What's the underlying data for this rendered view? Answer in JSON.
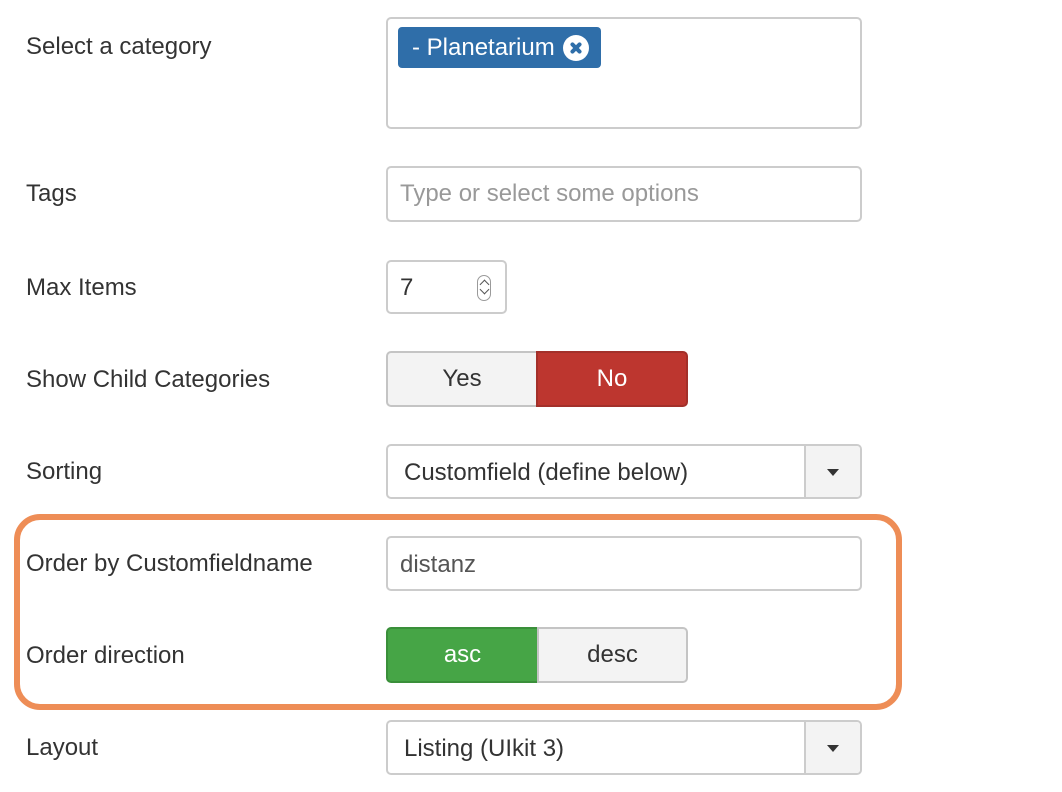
{
  "fields": {
    "category": {
      "label": "Select a category",
      "selected_chip": "- Planetarium",
      "remove_icon": "circle-x-icon"
    },
    "tags": {
      "label": "Tags",
      "placeholder": "Type or select some options"
    },
    "max_items": {
      "label": "Max Items",
      "value": "7"
    },
    "show_child_categories": {
      "label": "Show Child Categories",
      "options": [
        "Yes",
        "No"
      ],
      "selected": "No"
    },
    "sorting": {
      "label": "Sorting",
      "value": "Customfield (define below)"
    },
    "order_by_customfieldname": {
      "label": "Order by Customfieldname",
      "value": "distanz"
    },
    "order_direction": {
      "label": "Order direction",
      "options": [
        "asc",
        "desc"
      ],
      "selected": "asc"
    },
    "layout": {
      "label": "Layout",
      "value": "Listing (UIkit 3)"
    }
  },
  "colors": {
    "chip_blue": "#2f6ea9",
    "active_no_red": "#bd362f",
    "active_asc_green": "#46a546",
    "highlight_orange": "#ee8d56"
  }
}
